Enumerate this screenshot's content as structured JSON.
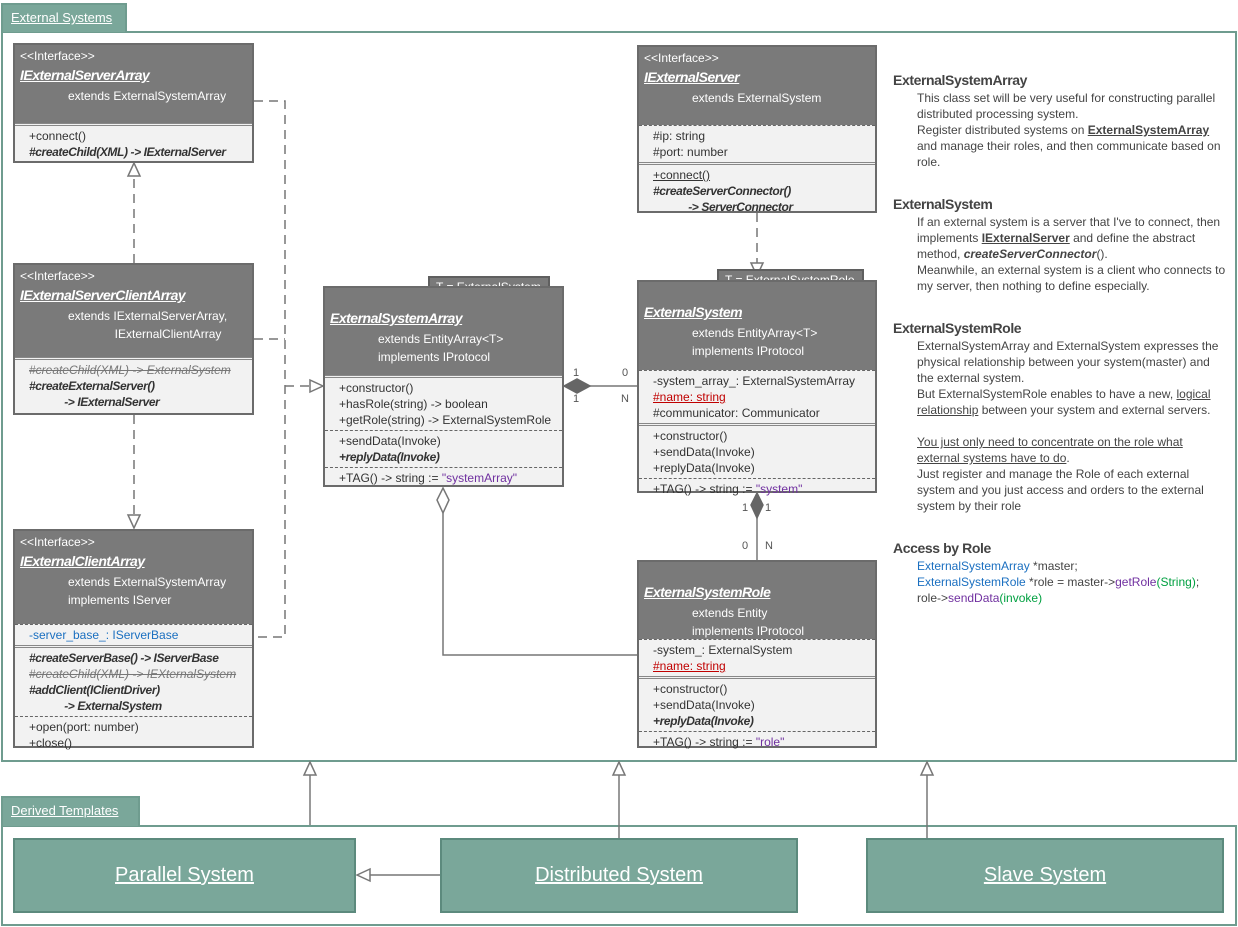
{
  "frames": {
    "external_systems": "External Systems",
    "derived_templates": "Derived Templates"
  },
  "colors": {
    "frame": "#7aa79a",
    "class_header": "#7a7a7a",
    "class_body": "#f2f2f2",
    "highlight_red": "#c00000",
    "keyword_blue": "#1a6fc0",
    "string_purple": "#7030a0",
    "code_green": "#00a040"
  },
  "classes": [
    {
      "id": "iexternalserverarray",
      "stereotype": "<<Interface>>",
      "name": "IExternalServerArray",
      "header": [
        "extends ExternalSystemArray"
      ],
      "sections": [
        {
          "double": true,
          "members": [
            {
              "text": "+connect()"
            },
            {
              "text": "#createChild(XML) -> IExternalServer",
              "style": "ib"
            }
          ]
        }
      ]
    },
    {
      "id": "iexternalserverclientarray",
      "stereotype": "<<Interface>>",
      "name": "IExternalServerClientArray",
      "header": [
        "extends IExternalServerArray,",
        "              IExternalClientArray"
      ],
      "sections": [
        {
          "double": true,
          "members": [
            {
              "text": "#createChild(XML) -> ExternalSystem",
              "style": "strike"
            },
            {
              "text": "#createExternalServer()",
              "style": "ib"
            },
            {
              "text": "            -> IExternalServer",
              "style": "ib"
            }
          ]
        }
      ]
    },
    {
      "id": "iexternalclientarray",
      "stereotype": "<<Interface>>",
      "name": "IExternalClientArray",
      "header": [
        "extends ExternalSystemArray",
        "implements IServer"
      ],
      "sections": [
        {
          "members": [
            {
              "text": "-server_base_: IServerBase",
              "style": "blue"
            }
          ]
        },
        {
          "double": true,
          "members": [
            {
              "text": "#createServerBase() -> IServerBase",
              "style": "ib"
            },
            {
              "text": "#createChild(XML) -> IEXternalSystem",
              "style": "strike"
            },
            {
              "text": "#addClient(IClientDriver)",
              "style": "ib"
            },
            {
              "text": "            -> ExternalSystem",
              "style": "ib"
            }
          ]
        },
        {
          "members": [
            {
              "text": "+open(port: number)"
            },
            {
              "text": "+close()"
            }
          ]
        }
      ]
    },
    {
      "id": "externalsystemarray",
      "template": "T = ExternalSystem",
      "name": "ExternalSystemArray",
      "header": [
        "extends EntityArray<T>",
        "implements IProtocol"
      ],
      "sections": [
        {
          "double": true,
          "members": [
            {
              "text": "+constructor()"
            },
            {
              "text": "+hasRole(string) -> boolean"
            },
            {
              "text": "+getRole(string) -> ExternalSystemRole"
            }
          ]
        },
        {
          "members": [
            {
              "text": "+sendData(Invoke)"
            },
            {
              "text": "+replyData(Invoke)",
              "style": "ib"
            }
          ]
        },
        {
          "members": [
            {
              "text": "+TAG() -> string := ",
              "value": "\"systemArray\""
            }
          ]
        }
      ]
    },
    {
      "id": "iexternalserver",
      "stereotype": "<<Interface>>",
      "name": "IExternalServer",
      "header": [
        "extends ExternalSystem"
      ],
      "sections": [
        {
          "members": [
            {
              "text": "#ip: string"
            },
            {
              "text": "#port: number"
            }
          ]
        },
        {
          "double": true,
          "members": [
            {
              "text": "+connect()",
              "style": "ul"
            },
            {
              "text": "#createServerConnector()",
              "style": "ib"
            },
            {
              "text": "            -> ServerConnector",
              "style": "ib"
            }
          ]
        }
      ]
    },
    {
      "id": "externalsystem",
      "template": "T = ExternalSystemRole",
      "name": "ExternalSystem",
      "header": [
        "extends EntityArray<T>",
        "implements IProtocol"
      ],
      "sections": [
        {
          "members": [
            {
              "text": "-system_array_: ExternalSystemArray"
            },
            {
              "text": "#name: string",
              "style": "red"
            },
            {
              "text": "#communicator: Communicator"
            }
          ]
        },
        {
          "double": true,
          "members": [
            {
              "text": "+constructor()"
            },
            {
              "text": "+sendData(Invoke)"
            },
            {
              "text": "+replyData(Invoke)"
            }
          ]
        },
        {
          "members": [
            {
              "text": "+TAG() -> string := ",
              "value": "\"system\""
            }
          ]
        }
      ]
    },
    {
      "id": "externalsystemrole",
      "name": "ExternalSystemRole",
      "header": [
        "extends Entity",
        "implements IProtocol"
      ],
      "sections": [
        {
          "members": [
            {
              "text": "-system_: ExternalSystem"
            },
            {
              "text": "#name: string",
              "style": "red"
            }
          ]
        },
        {
          "double": true,
          "members": [
            {
              "text": "+constructor()"
            },
            {
              "text": "+sendData(Invoke)"
            },
            {
              "text": "+replyData(Invoke)",
              "style": "ib"
            }
          ]
        },
        {
          "members": [
            {
              "text": "+TAG() -> string := ",
              "value": "\"role\""
            }
          ]
        }
      ]
    }
  ],
  "multiplicities": {
    "array_side_top": "1",
    "array_side_bottom": "1",
    "system_side_top": "0",
    "system_side_bottom": "N",
    "system_bottom_left": "1",
    "system_bottom_right": "1",
    "role_top_left": "0",
    "role_top_right": "N"
  },
  "notes": {
    "esa_title": "ExternalSystemArray",
    "esa_p1": "  This class set will be very useful for constructing parallel distributed processing system.",
    "esa_p2a": "  Register distributed systems on ",
    "esa_p2_link": "ExternalSystemArray",
    "esa_p2b": " and manage their roles, and then communicate based on role.",
    "es_title": "ExternalSystem",
    "es_p1a": "  If an external system is a server that I've to connect, then implements ",
    "es_p1_link": "IExternalServer",
    "es_p1b": " and define the abstract method, ",
    "es_p1_method": "createServerConnector",
    "es_p1c": "().",
    "es_p2": "  Meanwhile, an external system is a client who connects to my server, then nothing to define especially.",
    "esr_title": "ExternalSystemRole",
    "esr_p1": "  ExternalSystemArray and ExternalSystem expresses the physical relationship between your system(master) and the external system.",
    "esr_p2a": "  But ExternalSystemRole enables to have a new, ",
    "esr_p2_link": "logical relationship",
    "esr_p2b": " between your system and external servers.",
    "esr_p3_link": "  You just only need to concentrate on the role what external systems have to do",
    "esr_p3b": ".",
    "esr_p4": "  Just register and manage the Role of each external system and you just access and orders to the external system by their role",
    "abr_title": "Access by Role",
    "code1_type": "ExternalSystemArray",
    "code1_rest": " *master;",
    "code2_type": "ExternalSystemRole",
    "code2_mid": " *role = master->",
    "code2_fn": "getRole",
    "code2_arg": "(String)",
    "code2_end": ";",
    "code3_a": "role->",
    "code3_fn": "sendData",
    "code3_arg": "(invoke)"
  },
  "derived": {
    "parallel": "Parallel System",
    "distributed": "Distributed System",
    "slave": "Slave System"
  }
}
